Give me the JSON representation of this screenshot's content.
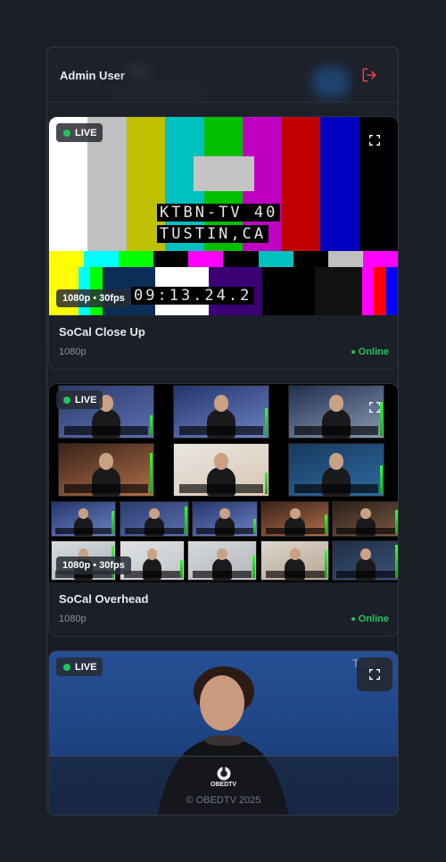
{
  "header": {
    "user_name": "Admin User"
  },
  "colors": {
    "accent_live": "#22c55e",
    "logout": "#ef4444"
  },
  "cameras": [
    {
      "badge": "LIVE",
      "resolution_badge": "1080p • 30fps",
      "title": "SoCal Close Up",
      "resolution": "1080p",
      "status": "Online",
      "feed": {
        "station_line_1": "KTBN-TV 40",
        "station_line_2": "TUSTIN,CA",
        "timecode": "09:13.24.2"
      }
    },
    {
      "badge": "LIVE",
      "resolution_badge": "1080p • 30fps",
      "title": "SoCal Overhead",
      "resolution": "1080p",
      "status": "Online"
    },
    {
      "badge": "LIVE",
      "watermark": "TBN"
    }
  ],
  "footer": {
    "logo_text": "OBEDTV",
    "copyright": "© OBEDTV 2025"
  },
  "icons": {
    "logout": "logout-icon",
    "fullscreen": "fullscreen-icon"
  }
}
